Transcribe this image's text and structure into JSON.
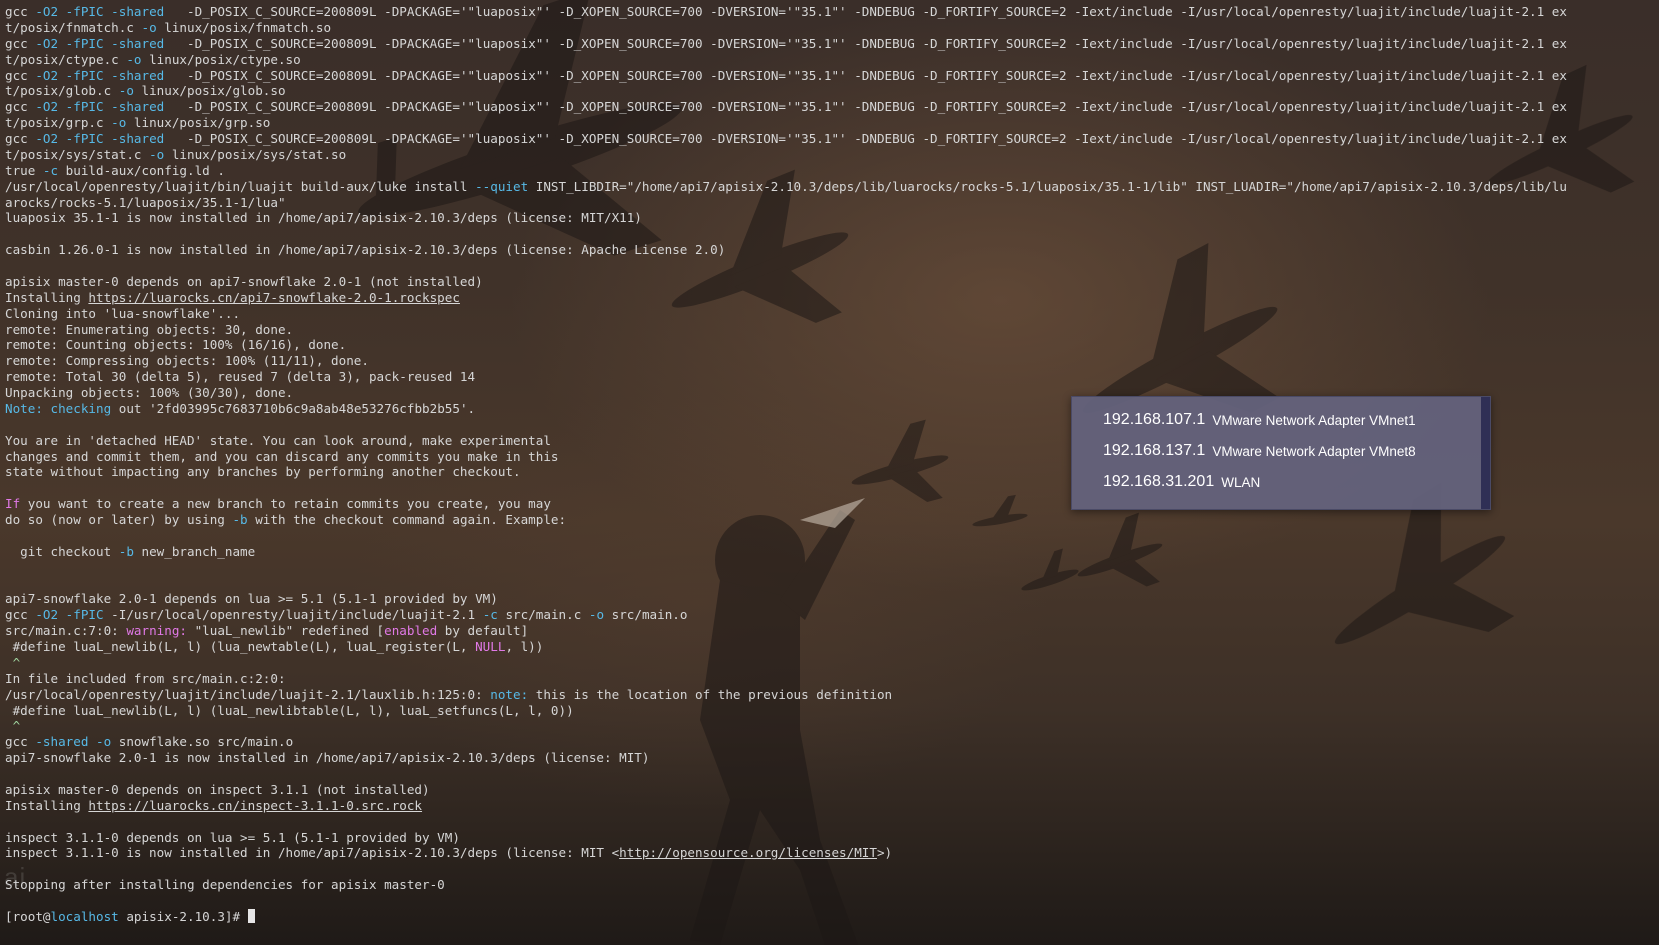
{
  "wallpaper": {
    "watermark": "ai"
  },
  "netpopup": {
    "rows": [
      {
        "ip": "192.168.107.1",
        "adapter": "VMware Network Adapter VMnet1"
      },
      {
        "ip": "192.168.137.1",
        "adapter": "VMware Network Adapter VMnet8"
      },
      {
        "ip": "192.168.31.201",
        "adapter": "WLAN"
      }
    ]
  },
  "terminal": {
    "lines": [
      [
        [
          "gcc ",
          ""
        ],
        [
          "-O2 -fPIC -shared",
          "flag"
        ],
        [
          "   ",
          ""
        ],
        [
          "-D_POSIX_C_SOURCE=200809L -DPACKAGE='\"luaposix\"' -D_XOPEN_SOURCE=700 -DVERSION='\"35.1\"' -DNDEBUG -D_FORTIFY_SOURCE=2 -Iext/include -I/usr/local/openresty/luajit/include/luajit-2.1 ex",
          ""
        ]
      ],
      [
        [
          "t/posix/fnmatch.c ",
          ""
        ],
        [
          "-o",
          "opt"
        ],
        [
          " linux/posix/fnmatch.so",
          ""
        ]
      ],
      [
        [
          "gcc ",
          ""
        ],
        [
          "-O2 -fPIC -shared",
          "flag"
        ],
        [
          "   ",
          ""
        ],
        [
          "-D_POSIX_C_SOURCE=200809L -DPACKAGE='\"luaposix\"' -D_XOPEN_SOURCE=700 -DVERSION='\"35.1\"' -DNDEBUG -D_FORTIFY_SOURCE=2 -Iext/include -I/usr/local/openresty/luajit/include/luajit-2.1 ex",
          ""
        ]
      ],
      [
        [
          "t/posix/ctype.c ",
          ""
        ],
        [
          "-o",
          "opt"
        ],
        [
          " linux/posix/ctype.so",
          ""
        ]
      ],
      [
        [
          "gcc ",
          ""
        ],
        [
          "-O2 -fPIC -shared",
          "flag"
        ],
        [
          "   ",
          ""
        ],
        [
          "-D_POSIX_C_SOURCE=200809L -DPACKAGE='\"luaposix\"' -D_XOPEN_SOURCE=700 -DVERSION='\"35.1\"' -DNDEBUG -D_FORTIFY_SOURCE=2 -Iext/include -I/usr/local/openresty/luajit/include/luajit-2.1 ex",
          ""
        ]
      ],
      [
        [
          "t/posix/glob.c ",
          ""
        ],
        [
          "-o",
          "opt"
        ],
        [
          " linux/posix/glob.so",
          ""
        ]
      ],
      [
        [
          "gcc ",
          ""
        ],
        [
          "-O2 -fPIC -shared",
          "flag"
        ],
        [
          "   ",
          ""
        ],
        [
          "-D_POSIX_C_SOURCE=200809L -DPACKAGE='\"luaposix\"' -D_XOPEN_SOURCE=700 -DVERSION='\"35.1\"' -DNDEBUG -D_FORTIFY_SOURCE=2 -Iext/include -I/usr/local/openresty/luajit/include/luajit-2.1 ex",
          ""
        ]
      ],
      [
        [
          "t/posix/grp.c ",
          ""
        ],
        [
          "-o",
          "opt"
        ],
        [
          " linux/posix/grp.so",
          ""
        ]
      ],
      [
        [
          "gcc ",
          ""
        ],
        [
          "-O2 -fPIC -shared",
          "flag"
        ],
        [
          "   ",
          ""
        ],
        [
          "-D_POSIX_C_SOURCE=200809L -DPACKAGE='\"luaposix\"' -D_XOPEN_SOURCE=700 -DVERSION='\"35.1\"' -DNDEBUG -D_FORTIFY_SOURCE=2 -Iext/include -I/usr/local/openresty/luajit/include/luajit-2.1 ex",
          ""
        ]
      ],
      [
        [
          "t/posix/sys/stat.c ",
          ""
        ],
        [
          "-o",
          "opt"
        ],
        [
          " linux/posix/sys/stat.so",
          ""
        ]
      ],
      [
        [
          "true ",
          ""
        ],
        [
          "-c",
          "opt"
        ],
        [
          " build-aux/config.ld .",
          ""
        ]
      ],
      [
        [
          "/usr/local/openresty/luajit/bin/luajit build-aux/luke install ",
          ""
        ],
        [
          "--quiet",
          "opt"
        ],
        [
          " INST_LIBDIR=\"/home/api7/apisix-2.10.3/deps/lib/luarocks/rocks-5.1/luaposix/35.1-1/lib\" INST_LUADIR=\"/home/api7/apisix-2.10.3/deps/lib/lu",
          ""
        ]
      ],
      [
        [
          "arocks/rocks-5.1/luaposix/35.1-1/lua\"",
          ""
        ]
      ],
      [
        [
          "luaposix 35.1-1 is now installed in /home/api7/apisix-2.10.3/deps (license: MIT/X11)",
          ""
        ]
      ],
      [],
      [
        [
          "casbin 1.26.0-1 is now installed in /home/api7/apisix-2.10.3/deps (license: Apache License 2.0)",
          ""
        ]
      ],
      [],
      [
        [
          "apisix master-0 depends on api7-snowflake 2.0-1 (not installed)",
          ""
        ]
      ],
      [
        [
          "Installing ",
          ""
        ],
        [
          "https://luarocks.cn/api7-snowflake-2.0-1.rockspec",
          "link"
        ]
      ],
      [
        [
          "Cloning into 'lua-snowflake'...",
          ""
        ]
      ],
      [
        [
          "remote: Enumerating objects: 30, done.",
          ""
        ]
      ],
      [
        [
          "remote: Counting objects: 100% (16/16), done.",
          ""
        ]
      ],
      [
        [
          "remote: Compressing objects: 100% (11/11), done.",
          ""
        ]
      ],
      [
        [
          "remote: Total 30 (delta 5), reused 7 (delta 3), pack-reused 14",
          ""
        ]
      ],
      [
        [
          "Unpacking objects: 100% (30/30), done.",
          ""
        ]
      ],
      [
        [
          "Note:",
          "note"
        ],
        [
          " ",
          ""
        ],
        [
          "checking",
          "note"
        ],
        [
          " out '2fd03995c7683710b6c9a8ab48e53276cfbb2b55'.",
          ""
        ]
      ],
      [],
      [
        [
          "You are in 'detached HEAD' state. You can look around, make experimental",
          ""
        ]
      ],
      [
        [
          "changes and commit them, and you can discard any commits you make in this",
          ""
        ]
      ],
      [
        [
          "state without impacting any branches by performing another checkout.",
          ""
        ]
      ],
      [],
      [
        [
          "If",
          "if"
        ],
        [
          " you want to create a new branch to retain commits you create, you may",
          ""
        ]
      ],
      [
        [
          "do so (now or later) by using ",
          ""
        ],
        [
          "-b",
          "opt"
        ],
        [
          " with the checkout command again. Example:",
          ""
        ]
      ],
      [],
      [
        [
          "  git checkout ",
          ""
        ],
        [
          "-b",
          "opt"
        ],
        [
          " new_branch_name",
          ""
        ]
      ],
      [],
      [],
      [
        [
          "api7-snowflake 2.0-1 depends on lua >= 5.1 (5.1-1 provided by VM)",
          ""
        ]
      ],
      [
        [
          "gcc ",
          ""
        ],
        [
          "-O2 -fPIC",
          "flag"
        ],
        [
          " -I/usr/local/openresty/luajit/include/luajit-2.1 ",
          ""
        ],
        [
          "-c",
          "opt"
        ],
        [
          " src/main.c ",
          ""
        ],
        [
          "-o",
          "opt"
        ],
        [
          " src/main.o",
          ""
        ]
      ],
      [
        [
          "src/main.c:7:0: ",
          ""
        ],
        [
          "warning:",
          "warn"
        ],
        [
          " \"luaL_newlib\" redefined [",
          ""
        ],
        [
          "enabled",
          "warn"
        ],
        [
          " by default]",
          ""
        ]
      ],
      [
        [
          " #define luaL_newlib(L, l) (lua_newtable(L), luaL_register(L, ",
          ""
        ],
        [
          "NULL",
          "null"
        ],
        [
          ", l))",
          ""
        ]
      ],
      [
        [
          " ^",
          "caret"
        ]
      ],
      [
        [
          "In file included from src/main.c:2:0:",
          ""
        ]
      ],
      [
        [
          "/usr/local/openresty/luajit/include/luajit-2.1/lauxlib.h:125:0: ",
          ""
        ],
        [
          "note:",
          "note"
        ],
        [
          " this is the location of the previous definition",
          ""
        ]
      ],
      [
        [
          " #define luaL_newlib(L, l) (luaL_newlibtable(L, l), luaL_setfuncs(L, l, 0))",
          ""
        ]
      ],
      [
        [
          " ^",
          "caret"
        ]
      ],
      [
        [
          "gcc ",
          ""
        ],
        [
          "-shared",
          "flag"
        ],
        [
          " ",
          ""
        ],
        [
          "-o",
          "opt"
        ],
        [
          " snowflake.so src/main.o",
          ""
        ]
      ],
      [
        [
          "api7-snowflake 2.0-1 is now installed in /home/api7/apisix-2.10.3/deps (license: MIT)",
          ""
        ]
      ],
      [],
      [
        [
          "apisix master-0 depends on inspect 3.1.1 (not installed)",
          ""
        ]
      ],
      [
        [
          "Installing ",
          ""
        ],
        [
          "https://luarocks.cn/inspect-3.1.1-0.src.rock",
          "link"
        ]
      ],
      [],
      [
        [
          "inspect 3.1.1-0 depends on lua >= 5.1 (5.1-1 provided by VM)",
          ""
        ]
      ],
      [
        [
          "inspect 3.1.1-0 is now installed in /home/api7/apisix-2.10.3/deps (license: MIT <",
          ""
        ],
        [
          "http://opensource.org/licenses/MIT",
          "link"
        ],
        [
          ">)",
          ""
        ]
      ],
      [],
      [
        [
          "Stopping after installing dependencies for apisix master-0",
          ""
        ]
      ],
      [],
      [
        [
          "[root@",
          ""
        ],
        [
          "localhost",
          "host"
        ],
        [
          " apisix-2.10.3]# ",
          ""
        ],
        [
          "",
          "cursor"
        ]
      ]
    ]
  }
}
